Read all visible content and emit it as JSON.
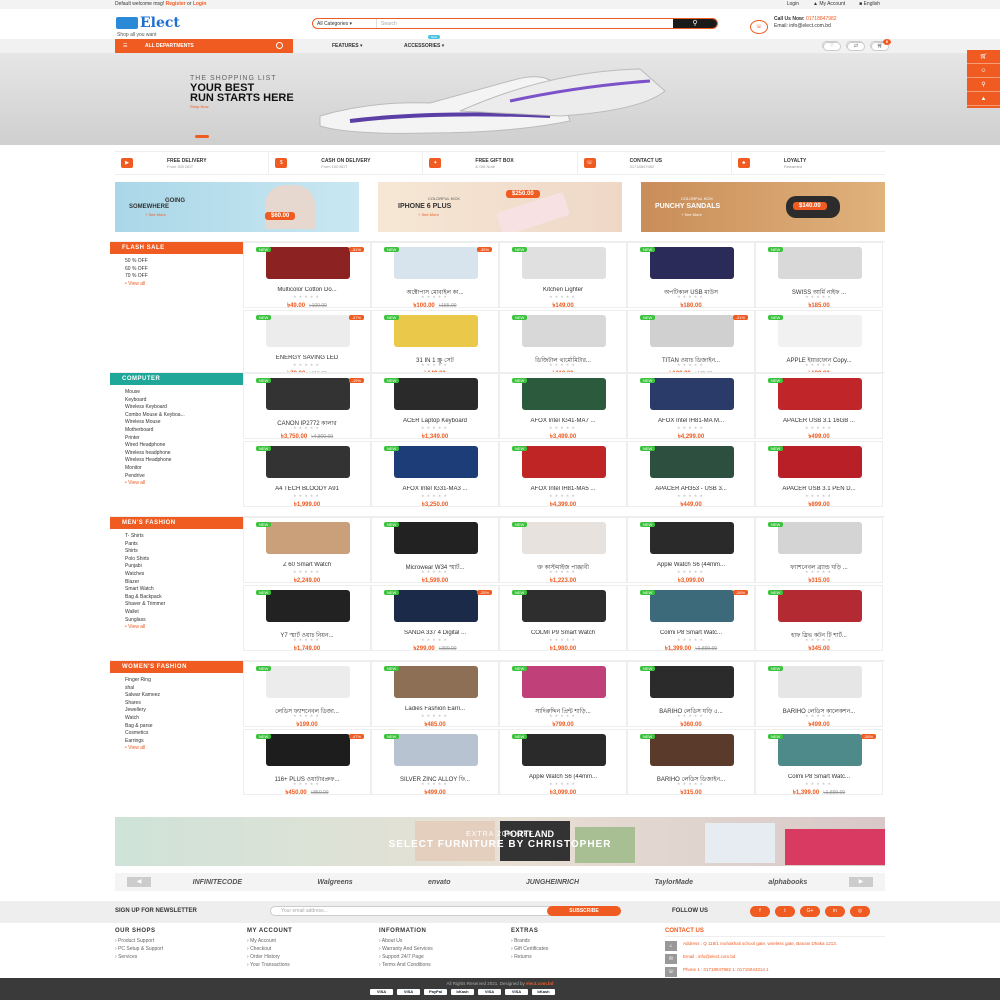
{
  "topbar": {
    "welcome": "Default welcome msg!",
    "register": "Register",
    "or": "or",
    "login": "Login",
    "login2": "Login",
    "account": "My Account",
    "lang": "English"
  },
  "header": {
    "logo": "Elect",
    "tagline": "Shop all you want",
    "category": "All Categories",
    "search_placeholder": "Search",
    "call_label": "Call Us Now:",
    "phone": "01718847982",
    "email": "Email: info@elect.com.bd"
  },
  "nav": {
    "all_departments": "ALL DEPARTMENTS",
    "features": "FEATURES",
    "accessories": "ACCESSORIES",
    "new_badge": "New",
    "cart_count": "0"
  },
  "hero": {
    "kicker": "THE SHOPPING LIST",
    "title1": "YOUR BEST",
    "title2": "RUN STARTS HERE",
    "cta": "Shop Now"
  },
  "features": [
    {
      "title": "FREE DELIVERY",
      "sub": "From 500 BDT"
    },
    {
      "title": "CASH ON DELIVERY",
      "sub": "From 100 BDT"
    },
    {
      "title": "FREE GIFT BOX",
      "sub": "& Gift Note"
    },
    {
      "title": "CONTACT US",
      "sub": "01718847982"
    },
    {
      "title": "LOYALTY",
      "sub": "Rewarded"
    }
  ],
  "banners": [
    {
      "title": "GOING",
      "title2": "SOMEWHERE",
      "more": "+ See More",
      "price": "$60.00"
    },
    {
      "kicker": "COLORFUL KICK",
      "title": "IPHONE 6 PLUS",
      "more": "+ See More",
      "price": "$250.00"
    },
    {
      "kicker": "COLORFUL KICK",
      "title": "PUNCHY SANDALS",
      "more": "+ See More",
      "price": "$140.00"
    }
  ],
  "sections": [
    {
      "title": "FLASH SALE",
      "items": [
        "50 % OFF",
        "60 % OFF",
        "70 % OFF"
      ],
      "view_all": "View all",
      "products": [
        {
          "name": "Multicolor Cotton Do...",
          "price": "৳49.00",
          "old": "৳100.00",
          "off": "-51%"
        },
        {
          "name": "অক্টোপাস মোবাইল কা...",
          "price": "৳100.00",
          "old": "৳155.00",
          "off": "-35%"
        },
        {
          "name": "Kitchen Lighter",
          "price": "৳149.00",
          "old": "",
          "off": ""
        },
        {
          "name": "অপটিকাল USB মাউস",
          "price": "৳180.00",
          "old": "",
          "off": ""
        },
        {
          "name": "SWISS আর্মি নাইফ ...",
          "price": "৳185.00",
          "old": "",
          "off": ""
        },
        {
          "name": "ENERGY SAVING LED",
          "price": "৳70.00",
          "old": "৳110.00",
          "off": "-37%"
        },
        {
          "name": "31 IN 1 স্ক্রু সেট",
          "price": "৳149.00",
          "old": "",
          "off": ""
        },
        {
          "name": "ডিজিটাল থার্মোমিটার...",
          "price": "৳110.00",
          "old": "",
          "off": ""
        },
        {
          "name": "TITAN ওয়াচ ডিজাইন...",
          "price": "৳120.00",
          "old": "৳175.00",
          "off": "-31%"
        },
        {
          "name": "APPLE ইয়ারফোন Copy...",
          "price": "৳199.00",
          "old": "",
          "off": ""
        }
      ]
    },
    {
      "title": "COMPUTER",
      "items": [
        "Mouse",
        "Keyboard",
        "Wireless Keyboard",
        "Combo Mouse & Keyboa...",
        "Wireless Mouse",
        "Motherboard",
        "Printer",
        "Wired Headphone",
        "Wireless headphone",
        "Wireless Headphone",
        "Monitor",
        "Pendrive"
      ],
      "view_all": "View all",
      "products": [
        {
          "name": "CANON IP2772 কালার",
          "price": "৳3,750.00",
          "old": "৳4,800.00",
          "off": "-19%"
        },
        {
          "name": "ACER Laptop Keyboard",
          "price": "৳1,349.00",
          "old": "",
          "off": ""
        },
        {
          "name": "AFOX Intel IG41-MA7 ...",
          "price": "৳3,499.00",
          "old": "",
          "off": ""
        },
        {
          "name": "AFOX Intel IH81-MA M...",
          "price": "৳4,299.00",
          "old": "",
          "off": ""
        },
        {
          "name": "APACER USB 3.1 16GB ...",
          "price": "৳499.00",
          "old": "",
          "off": ""
        },
        {
          "name": "A4 TECH BLOODY A91",
          "price": "৳1,999.00",
          "old": "",
          "off": ""
        },
        {
          "name": "AFOX Intel IG31-MA3 ...",
          "price": "৳3,250.00",
          "old": "",
          "off": ""
        },
        {
          "name": "AFOX Intel IH81-MA5 ...",
          "price": "৳4,399.00",
          "old": "",
          "off": ""
        },
        {
          "name": "APACER AH353 - USB 3...",
          "price": "৳449.00",
          "old": "",
          "off": ""
        },
        {
          "name": "APACER USB 3.1 PEN D...",
          "price": "৳899.00",
          "old": "",
          "off": ""
        }
      ]
    },
    {
      "title": "MEN'S FASHION",
      "items": [
        "T- Shirts",
        "Pants",
        "Shirts",
        "Polo Shirts",
        "Punjabi",
        "Watches",
        "Blazer",
        "Smart Watch",
        "Bag & Backpack",
        "Shaver & Trimmer",
        "Wallet",
        "Sunglass"
      ],
      "view_all": "View all",
      "products": [
        {
          "name": "Z 60 Smart Watch",
          "price": "৳2,249.00",
          "old": "",
          "off": ""
        },
        {
          "name": "Microwear W34 স্মার্ট...",
          "price": "৳1,599.00",
          "old": "",
          "off": ""
        },
        {
          "name": "ক্ত কাস্টমাইজ পাঞ্জাবী",
          "price": "৳1,223.00",
          "old": "",
          "off": ""
        },
        {
          "name": "Apple Watch S6 (44mm...",
          "price": "৳3,099.00",
          "old": "",
          "off": ""
        },
        {
          "name": "ফ্যাশনেবল ব্র্যান্ড ঘড়ি ...",
          "price": "৳315.00",
          "old": "",
          "off": ""
        },
        {
          "name": "Y7 স্মার্ট ওয়াচ নিয়ন...",
          "price": "৳1,749.00",
          "old": "",
          "off": ""
        },
        {
          "name": "SANDA 337 4 Digital ...",
          "price": "৳299.00",
          "old": "৳399.00",
          "off": "-25%"
        },
        {
          "name": "COLMI P9 Smart Watch",
          "price": "৳1,980.00",
          "old": "",
          "off": ""
        },
        {
          "name": "Colmi P8 Smart Watc...",
          "price": "৳1,399.00",
          "old": "৳1,899.00",
          "off": "-26%"
        },
        {
          "name": "হাফ স্লিভ কটন টি শার্ট...",
          "price": "৳345.00",
          "old": "",
          "off": ""
        }
      ]
    },
    {
      "title": "WOMEN'S FASHION",
      "items": [
        "Finger Ring",
        "shal",
        "Salwar Kameez",
        "Shares",
        "Jewellery",
        "Watch",
        "Bag & parse",
        "Cosmetics",
        "Earrings"
      ],
      "view_all": "View all",
      "products": [
        {
          "name": "লেডিস ফ্যাশনেবল ডিজা...",
          "price": "৳199.00",
          "old": "",
          "off": ""
        },
        {
          "name": "Ladies Fashion Earri...",
          "price": "৳485.00",
          "old": "",
          "off": ""
        },
        {
          "name": "সাদিরুদ্দিন প্রিন্ট শাড়ি...",
          "price": "৳799.00",
          "old": "",
          "off": ""
        },
        {
          "name": "BARIHO লেডিস ঘড়ি ৫...",
          "price": "৳360.00",
          "old": "",
          "off": ""
        },
        {
          "name": "BARIHO লেডিস কালেকশন...",
          "price": "৳499.00",
          "old": "",
          "off": ""
        },
        {
          "name": "116+ PLUS ওয়াটারপ্রুফ...",
          "price": "৳450.00",
          "old": "৳850.00",
          "off": "-47%"
        },
        {
          "name": "SILVER ZINC ALLOY ফি...",
          "price": "৳499.00",
          "old": "",
          "off": ""
        },
        {
          "name": "Apple Watch S6 (44mm...",
          "price": "৳3,099.00",
          "old": "",
          "off": ""
        },
        {
          "name": "BARIHO লেডিস ডিজাইন...",
          "price": "৳315.00",
          "old": "",
          "off": ""
        },
        {
          "name": "Colmi P8 Smart Watc...",
          "price": "৳1,399.00",
          "old": "৳1,899.00",
          "off": "-26%"
        }
      ]
    }
  ],
  "new_label": "NEW",
  "stars": "★★★★★",
  "promo": {
    "kicker": "EXTRA 20% OFF",
    "title": "SELECT FURNITURE BY CHRISTOPHER"
  },
  "brands": [
    "INFINITECODE",
    "Walgreens",
    "envato",
    "JUNGHEINRICH",
    "TaylorMade",
    "alphabooks"
  ],
  "newsletter": {
    "title": "SIGN UP FOR NEWSLETTER",
    "placeholder": "Your email address...",
    "button": "SUBSCRIBE",
    "follow": "FOLLOW US"
  },
  "footer": {
    "cols": [
      {
        "h": "OUR SHOPS",
        "items": [
          "Product Support",
          "PC Setup & Support",
          "Services"
        ]
      },
      {
        "h": "MY ACCOUNT",
        "items": [
          "My Account",
          "Checkout",
          "Order History",
          "Your Transactions"
        ]
      },
      {
        "h": "INFORMATION",
        "items": [
          "About Us",
          "Warranty And Services",
          "Support 24/7 Page",
          "Terms And Conditions"
        ]
      },
      {
        "h": "EXTRAS",
        "items": [
          "Brands",
          "Gift Certificates",
          "Returns"
        ]
      }
    ],
    "contact_h": "CONTACT US",
    "address": "Address : Q 118/1 mohakhali school gate, wireless gate, Banani Dhaka 1213.",
    "email": "Email : info@elect.com.bd",
    "phone": "Phone 1 : 01718847982 1: 01715044314 1"
  },
  "copyright": "All Rights Reserved 2021. Designed by ",
  "copyright_brand": "elect.com.bd",
  "payments": [
    "VISA",
    "VISA",
    "PayPal",
    "bKash",
    "VISA",
    "VISA",
    "bKash"
  ],
  "colors": {
    "accent": "#ef5b21",
    "section_teal": "#1fa89a"
  }
}
